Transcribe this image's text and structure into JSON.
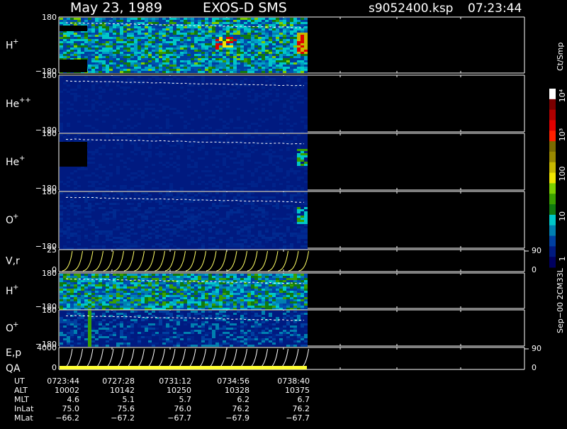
{
  "header": {
    "date": "May 23, 1989",
    "mission": "EXOS-D SMS",
    "file": "s9052400.ksp",
    "time": "07:23:44"
  },
  "colorbar": {
    "unit": "Ct/Smp",
    "ticks": [
      "10⁴",
      "10³",
      "100",
      "10",
      "1"
    ],
    "colors": [
      "#ffffff",
      "#7a0000",
      "#b00000",
      "#e00000",
      "#ff2000",
      "#7a6a00",
      "#9a8800",
      "#c8b800",
      "#f0e600",
      "#7ccf00",
      "#3aa000",
      "#107a10",
      "#00c8c8",
      "#0080b0",
      "#0040a0",
      "#001a80",
      "#000060"
    ]
  },
  "panels": [
    {
      "label": "H",
      "sup": "+",
      "ytop": "180",
      "ybot": "−180",
      "type": "spectrogram",
      "scheme": "hp"
    },
    {
      "label": "He",
      "sup": "++",
      "ytop": "180",
      "ybot": "−180",
      "type": "spectrogram",
      "scheme": "hepp"
    },
    {
      "label": "He",
      "sup": "+",
      "ytop": "180",
      "ybot": "−180",
      "type": "spectrogram",
      "scheme": "hep"
    },
    {
      "label": "O",
      "sup": "+",
      "ytop": "180",
      "ybot": "−180",
      "type": "spectrogram",
      "scheme": "op"
    },
    {
      "label": "V,r",
      "sup": "",
      "ytop": "25",
      "ybot": "0",
      "type": "lines",
      "rtop": "90",
      "rbot": "0"
    },
    {
      "label": "H",
      "sup": "+",
      "ytop": "180",
      "ybot": "−180",
      "type": "spectrogram",
      "scheme": "hp2"
    },
    {
      "label": "O",
      "sup": "+",
      "ytop": "180",
      "ybot": "−180",
      "type": "spectrogram",
      "scheme": "op2"
    },
    {
      "label": "E,p",
      "sup": "",
      "label2": "QA",
      "ytop": "4000",
      "ybot": "0",
      "type": "lines",
      "rtop": "90",
      "rbot": "0"
    }
  ],
  "footer": {
    "rows": [
      {
        "name": "UT",
        "values": [
          "0723:44",
          "0727:28",
          "0731:12",
          "0734:56",
          "0738:40"
        ]
      },
      {
        "name": "ALT",
        "values": [
          "10002",
          "10142",
          "10250",
          "10328",
          "10375"
        ]
      },
      {
        "name": "MLT",
        "values": [
          "4.6",
          "5.1",
          "5.7",
          "6.2",
          "6.7"
        ]
      },
      {
        "name": "InLat",
        "values": [
          "75.0",
          "75.6",
          "76.0",
          "76.2",
          "76.2"
        ]
      },
      {
        "name": "MLat",
        "values": [
          "−66.2",
          "−67.2",
          "−67.7",
          "−67.9",
          "−67.7"
        ]
      }
    ],
    "side_note": "Sep−00 2CM33L"
  },
  "chart_data": {
    "type": "heatmap",
    "title": "May 23, 1989   EXOS-D SMS",
    "x": [
      "0723:44",
      "0727:28",
      "0731:12",
      "0734:56",
      "0738:40"
    ],
    "ylim": [
      -180,
      180
    ],
    "colorbar_unit": "Ct/Smp",
    "colorbar_ticks": [
      "1",
      "10",
      "100",
      "10³",
      "10⁴"
    ]
  }
}
